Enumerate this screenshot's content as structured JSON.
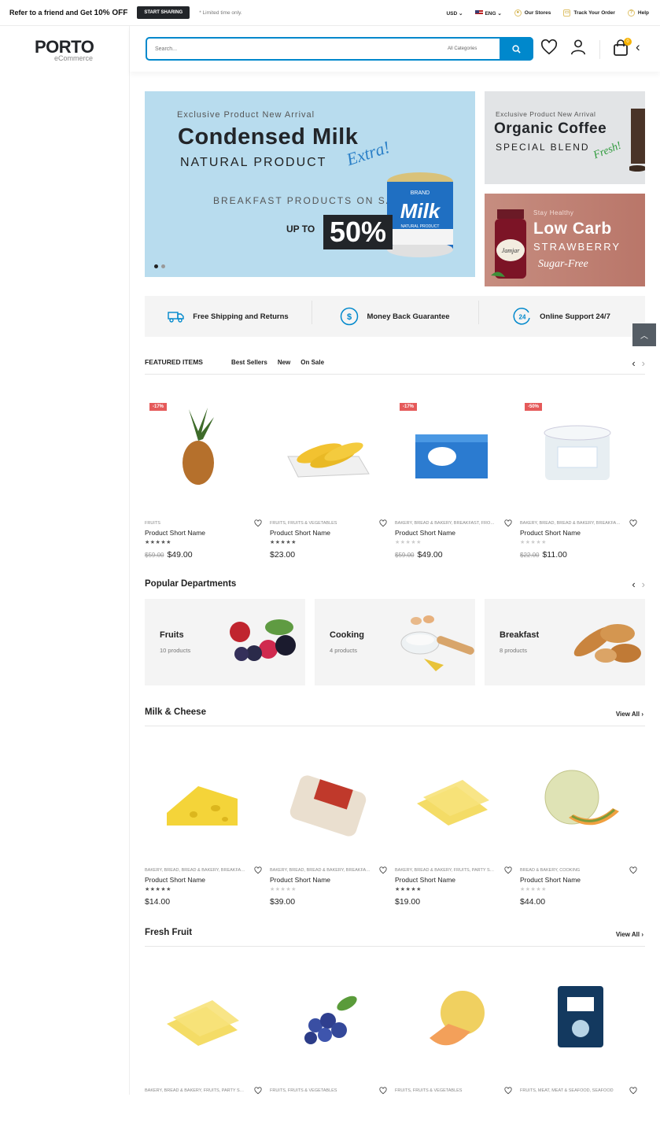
{
  "topbar": {
    "promo_text": "Refer to a friend and Get ",
    "promo_bold": "10% OFF",
    "share_button": "START SHARING",
    "limited": "* Limited time only.",
    "currency": "USD",
    "language": "ENG",
    "stores": "Our Stores",
    "track": "Track Your Order",
    "help": "Help"
  },
  "logo": {
    "name": "PORTO",
    "sub": "eCommerce"
  },
  "search": {
    "placeholder": "Search...",
    "category": "All Categories"
  },
  "cart": {
    "count": "0"
  },
  "hero": {
    "kicker": "Exclusive Product New Arrival",
    "title": "Condensed Milk",
    "subtitle": "NATURAL PRODUCT",
    "script": "Extra!",
    "line": "BREAKFAST PRODUCTS ON SALE",
    "upto": "UP TO",
    "percent": "50%",
    "can_label": "Milk",
    "can_brand": "BRAND",
    "can_sub": "NATURAL PRODUCT"
  },
  "banner_coffee": {
    "kicker": "Exclusive Product New Arrival",
    "title": "Organic Coffee",
    "subtitle": "SPECIAL BLEND",
    "script": "Fresh!"
  },
  "banner_strawberry": {
    "kicker": "Stay Healthy",
    "title": "Low Carb",
    "subtitle": "STRAWBERRY",
    "script": "Sugar-Free",
    "jar_label": "Jamjar"
  },
  "services": [
    {
      "icon": "truck-icon",
      "label": "Free Shipping and Returns"
    },
    {
      "icon": "dollar-icon",
      "label": "Money Back Guarantee"
    },
    {
      "icon": "support-24-icon",
      "label": "Online Support 24/7"
    }
  ],
  "featured": {
    "title": "FEATURED ITEMS",
    "tabs": [
      "Best Sellers",
      "New",
      "On Sale"
    ],
    "products": [
      {
        "badge": "-17%",
        "category": "FRUITS",
        "name": "Product Short Name",
        "rated": true,
        "old_price": "$59.00",
        "price": "$49.00",
        "image": "pineapple"
      },
      {
        "badge": "",
        "category": "FRUITS, FRUITS & VEGETABLES",
        "name": "Product Short Name",
        "rated": true,
        "old_price": "",
        "price": "$23.00",
        "image": "bananas"
      },
      {
        "badge": "-17%",
        "category": "BAKERY, BREAD & BAKERY, BREAKFAST, FROZ...",
        "name": "Product Short Name",
        "rated": false,
        "old_price": "$59.00",
        "price": "$49.00",
        "image": "cream-cheese"
      },
      {
        "badge": "-50%",
        "category": "BAKERY, BREAD, BREAD & BAKERY, BREAKFAS...",
        "name": "Product Short Name",
        "rated": false,
        "old_price": "$22.00",
        "price": "$11.00",
        "image": "yogurt"
      }
    ]
  },
  "departments": {
    "title": "Popular Departments",
    "items": [
      {
        "name": "Fruits",
        "count": "10 products",
        "image": "berries"
      },
      {
        "name": "Cooking",
        "count": "4 products",
        "image": "baking"
      },
      {
        "name": "Breakfast",
        "count": "8 products",
        "image": "bread"
      }
    ]
  },
  "milk_cheese": {
    "title": "Milk & Cheese",
    "view_all": "View All",
    "products": [
      {
        "category": "BAKERY, BREAD, BREAD & BAKERY, BREAKFAS...",
        "name": "Product Short Name",
        "rated": true,
        "price": "$14.00",
        "image": "cheese-wedge"
      },
      {
        "category": "BAKERY, BREAD, BREAD & BAKERY, BREAKFAST",
        "name": "Product Short Name",
        "rated": false,
        "price": "$39.00",
        "image": "cheese-pack"
      },
      {
        "category": "BAKERY, BREAD & BAKERY, FRUITS, PARTY SU...",
        "name": "Product Short Name",
        "rated": true,
        "price": "$19.00",
        "image": "cheese-slices"
      },
      {
        "category": "BREAD & BAKERY, COOKING",
        "name": "Product Short Name",
        "rated": false,
        "price": "$44.00",
        "image": "melon"
      }
    ]
  },
  "fresh_fruit": {
    "title": "Fresh Fruit",
    "view_all": "View All",
    "products": [
      {
        "category": "BAKERY, BREAD & BAKERY, FRUITS, PARTY SU...",
        "image": "cheese-slices"
      },
      {
        "category": "FRUITS, FRUITS & VEGETABLES",
        "image": "blueberries"
      },
      {
        "category": "FRUITS, FRUITS & VEGETABLES",
        "image": "pear-melon"
      },
      {
        "category": "FRUITS, MEAT, MEAT & SEAFOOD, SEAFOOD",
        "image": "shrimp-bag"
      }
    ]
  },
  "colors": {
    "accent": "#0088cc",
    "sale": "#e55a5a",
    "dark": "#222529",
    "hero_bg": "#b8dcee"
  }
}
